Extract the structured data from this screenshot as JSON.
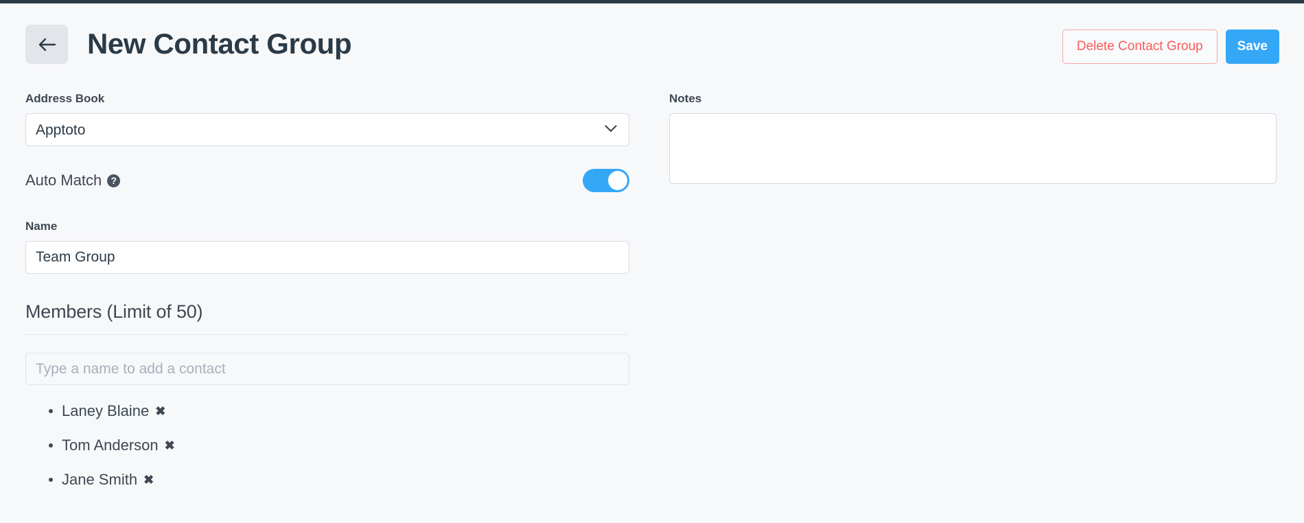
{
  "header": {
    "back_icon": "arrow-left-icon",
    "title": "New Contact Group",
    "delete_label": "Delete Contact Group",
    "save_label": "Save"
  },
  "colors": {
    "accent_blue": "#35a7f7",
    "danger_red": "#fc5a5a",
    "title_navy": "#2b3a47",
    "page_background": "#f7f8fa",
    "top_rule": "#2b3a47"
  },
  "form": {
    "address_book": {
      "label": "Address Book",
      "value": "Apptoto",
      "chevron_icon": "chevron-down-icon"
    },
    "auto_match": {
      "label": "Auto Match",
      "help_icon": "help-circle-icon",
      "help_glyph": "?",
      "enabled": true
    },
    "name": {
      "label": "Name",
      "value": "Team Group",
      "placeholder": ""
    },
    "members": {
      "heading": "Members (Limit of 50)",
      "search_placeholder": "Type a name to add a contact",
      "search_value": "",
      "remove_glyph": "✖",
      "list": [
        {
          "name": "Laney Blaine"
        },
        {
          "name": "Tom Anderson"
        },
        {
          "name": "Jane Smith"
        }
      ]
    },
    "notes": {
      "label": "Notes",
      "value": "",
      "placeholder": ""
    }
  }
}
